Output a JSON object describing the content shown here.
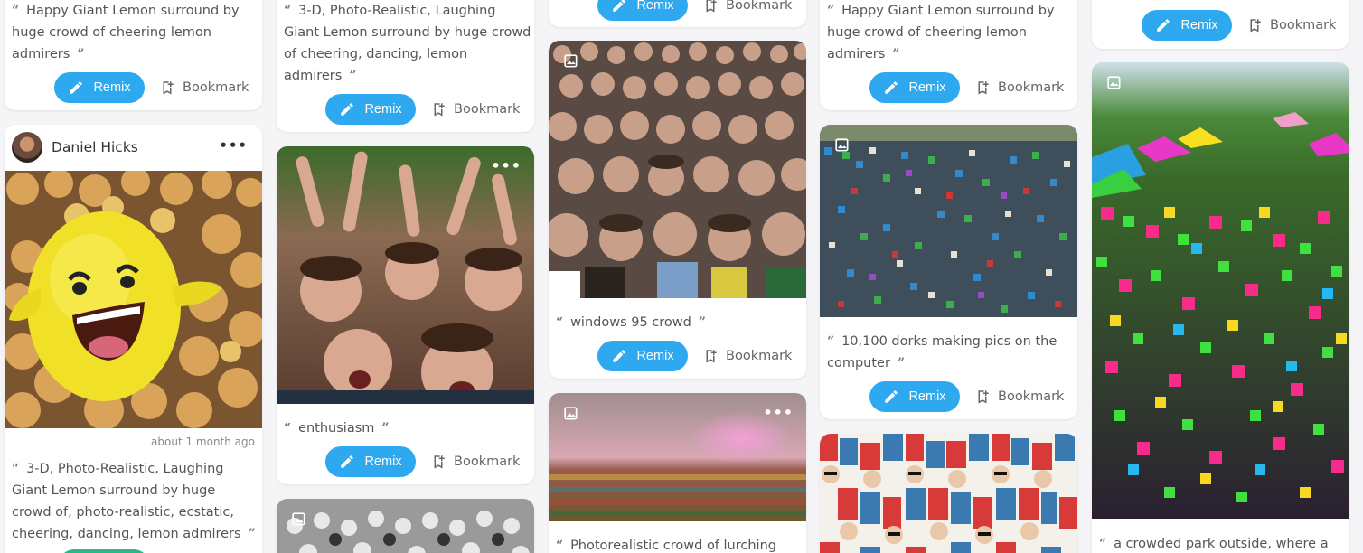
{
  "common": {
    "remix_label": "Remix",
    "bookmark_label": "Bookmark",
    "quote_open": "“",
    "quote_close": "”"
  },
  "cards": {
    "c1a": {
      "prompt": "Happy Giant Lemon surround by huge crowd of cheering lemon admirers"
    },
    "c1b": {
      "user_name": "Daniel Hicks",
      "more": "•••",
      "timestamp": "about 1 month ago",
      "prompt": "3-D, Photo-Realistic, Laughing Giant Lemon surround by huge crowd of, photo-realistic, ecstatic, cheering, dancing, lemon admirers"
    },
    "c2a": {
      "prompt": "3-D, Photo-Realistic, Laughing Giant Lemon surround by huge crowd of cheering, dancing, lemon admirers"
    },
    "c2b": {
      "prompt": "enthusiasm",
      "more": "•••"
    },
    "c3b": {
      "prompt": "windows 95 crowd"
    },
    "c3c": {
      "prompt": "Photorealistic crowd of lurching",
      "more": "•••"
    },
    "c4a": {
      "prompt": "Happy Giant Lemon surround by huge crowd of cheering lemon admirers"
    },
    "c4b": {
      "prompt": "10,100 dorks making pics on the computer"
    },
    "c5b": {
      "prompt": "a crowded park outside, where a"
    }
  },
  "colors": {
    "accent": "#2ea8ee"
  }
}
